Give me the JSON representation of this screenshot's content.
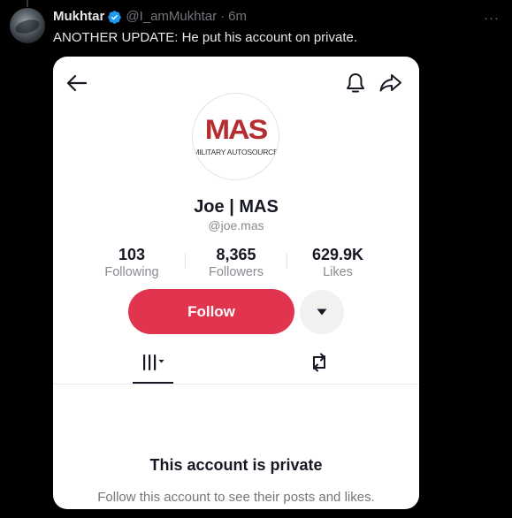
{
  "tweet": {
    "author_name": "Mukhtar",
    "author_handle": "@I_amMukhtar",
    "separator": "·",
    "time": "6m",
    "text": "ANOTHER UPDATE: He put his account on private."
  },
  "profile": {
    "logo_mark": "MAS",
    "logo_subtitle": "MILITARY AUTOSOURCE",
    "name": "Joe | MAS",
    "username": "@joe.mas",
    "stats": [
      {
        "value": "103",
        "label": "Following"
      },
      {
        "value": "8,365",
        "label": "Followers"
      },
      {
        "value": "629.9K",
        "label": "Likes"
      }
    ],
    "follow_label": "Follow",
    "private_title": "This account is private",
    "private_description": "Follow this account to see their posts and likes."
  },
  "icons": {
    "avatar": "user-avatar",
    "verified": "verified-badge-icon",
    "more": "more-options-icon",
    "back": "back-arrow-icon",
    "bell": "bell-icon",
    "share": "share-icon",
    "dropdown": "caret-down-icon",
    "grid_tab": "grid-tab-icon",
    "repost_tab": "repost-icon"
  },
  "colors": {
    "background": "#000000",
    "verified_blue": "#1d9bf0",
    "follow_red": "#e1344f",
    "logo_red": "#b62d32"
  }
}
